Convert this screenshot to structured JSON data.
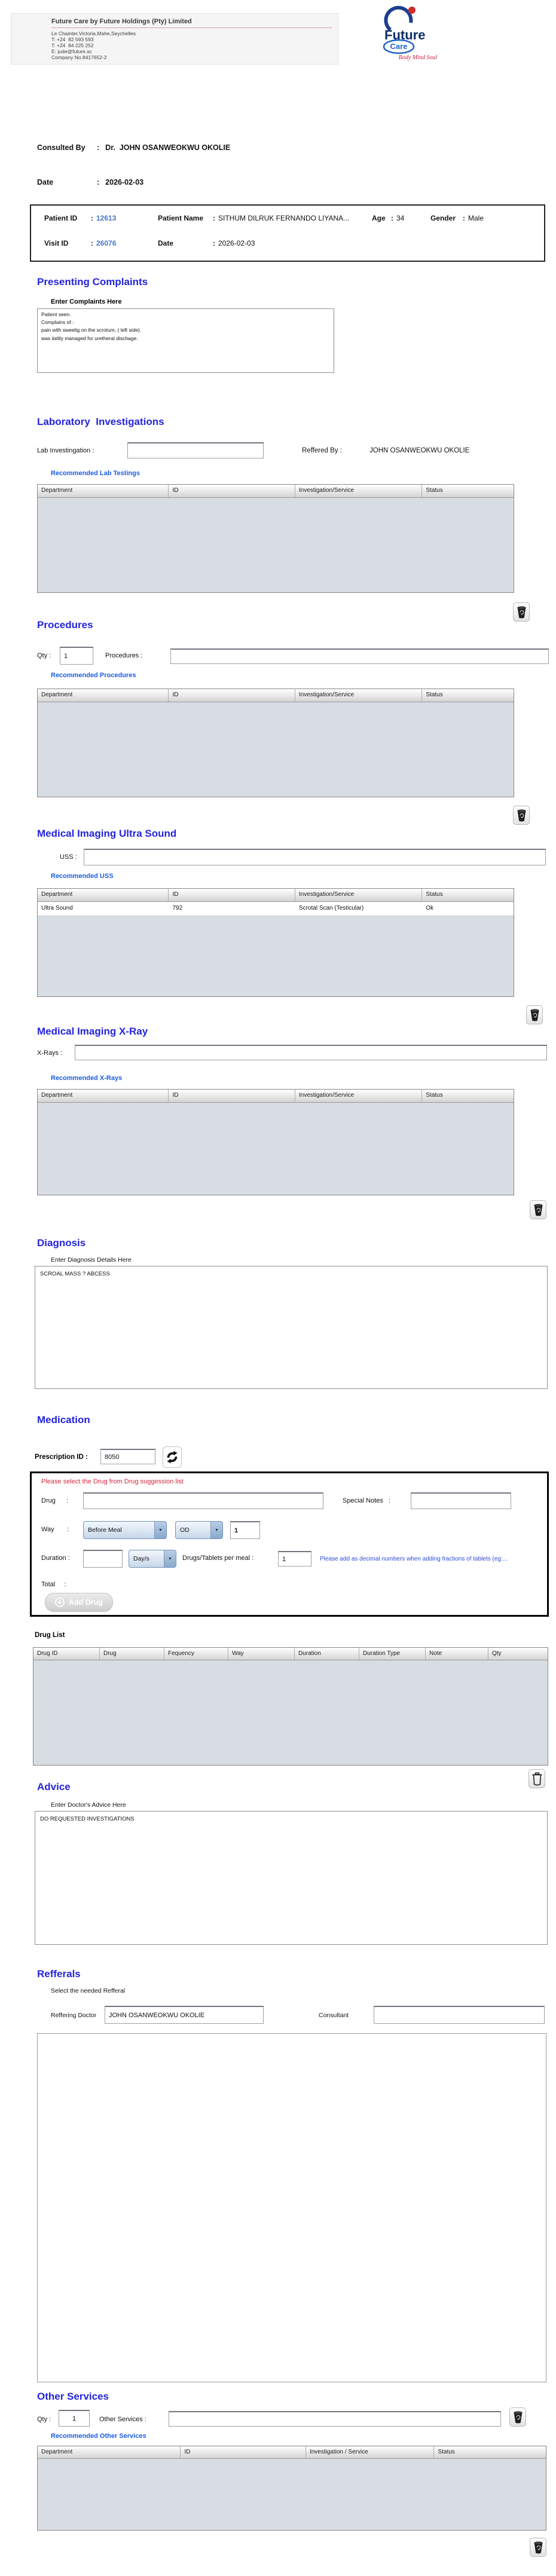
{
  "sep": ":",
  "header": {
    "company_name": "Future Care by Future Holdings (Pty) Limited",
    "address_lines": [
      "Le Chainter,Victoria,Mahe,Seychelles",
      "T: +24  82 593 593",
      "T: +24  84 225 252",
      "E: jude@future.sc",
      "Company No.8417652-2"
    ],
    "logo": {
      "name_top": "Future",
      "name_bottom": "Care",
      "tagline": "Body Mind Soul"
    }
  },
  "consult": {
    "consulted_by_label": "Consulted By",
    "consulted_by_value": "Dr.  JOHN OSANWEOKWU OKOLIE",
    "date_label": "Date",
    "date_value": "2026-02-03"
  },
  "patient": {
    "patient_id_label": "Patient ID",
    "patient_id": "12613",
    "patient_name_label": "Patient Name",
    "patient_name": "SITHUM DILRUK FERNANDO LIYANA...",
    "age_label": "Age",
    "age": "34",
    "gender_label": "Gender",
    "gender": "Male",
    "visit_id_label": "Visit ID",
    "visit_id": "26076",
    "date_label": "Date",
    "date": "2026-02-03"
  },
  "complaints": {
    "title": "Presenting Complaints",
    "label": "Enter Complaints Here",
    "text": "Patient seen.\nComplains of :\npain with sweelig on the scrotum, ( left side).\nwas iiattly managed for uretheral dischage."
  },
  "laboratory": {
    "title": "Laboratory  Investigations",
    "input_label": "Lab Investingation :",
    "input_value": "",
    "reffered_by_label": "Reffered By :",
    "reffered_by": "JOHN OSANWEOKWU OKOLIE",
    "link": "Recommended Lab Testings",
    "table": {
      "columns": [
        "Department",
        "ID",
        "Investigation/Service",
        "Status"
      ]
    }
  },
  "procedures": {
    "title": "Procedures",
    "qty_label": "Qty :",
    "qty_value": "1",
    "input_label": "Procedures :",
    "input_value": "",
    "link": "Recommended Procedures",
    "table": {
      "columns": [
        "Department",
        "ID",
        "Investigation/Service",
        "Status"
      ]
    }
  },
  "uss": {
    "title": "Medical Imaging Ultra Sound",
    "input_label": "USS :",
    "input_value": "",
    "link": "Recommended USS",
    "table": {
      "columns": [
        "Department",
        "ID",
        "Investigation/Service",
        "Status"
      ],
      "rows": [
        [
          "Ultra Sound",
          "792",
          "Scrotal Scan (Testicular)",
          "Ok"
        ]
      ]
    }
  },
  "xray": {
    "title": "Medical Imaging X-Ray",
    "input_label": "X-Rays :",
    "input_value": "",
    "link": "Recommended X-Rays",
    "table": {
      "columns": [
        "Department",
        "ID",
        "Investigation/Service",
        "Status"
      ]
    }
  },
  "diagnosis": {
    "title": "Diagnosis",
    "label": "Enter Diagnosis Details Here",
    "text": "SCROAL MASS ? ABCESS"
  },
  "medication": {
    "title": "Medication",
    "prescription_id_label": "Prescription ID :",
    "prescription_id": "8050",
    "panel_warning": "Please select the Drug from Drug suggession list",
    "drug_label": "Drug      :",
    "drug_value": "",
    "special_notes_label": "Special Notes   :",
    "special_notes_value": "",
    "way_label": "Way       :",
    "way_select": "Before Meal",
    "frequency_select": "OD",
    "frequency_qty": "1",
    "duration_label": "Duration :",
    "duration_value": "",
    "duration_type_select": "Day/s",
    "per_meal_label": "Drugs/Tablets per meal :",
    "per_meal_value": "1",
    "fraction_note": "Please add as decimal numbers when adding fractions of tablets (eg:...",
    "total_label": "Total     :",
    "add_drug_button": "Add Drug",
    "drug_list_label": "Drug List",
    "table": {
      "columns": [
        "Drug ID",
        "Drug",
        "Fequency",
        "Way",
        "Duration",
        "Duration Type",
        "Note",
        "Qty"
      ]
    }
  },
  "advice": {
    "title": "Advice",
    "label": "Enter Doctor's Advice Here",
    "text": "DO REQUESTED INVESTIGATIONS"
  },
  "refferals": {
    "title": "Refferals",
    "label": "Select the needed Refferal",
    "reffering_doctor_label": "Reffering Doctor",
    "reffering_doctor": "JOHN OSANWEOKWU OKOLIE",
    "consultant_label": "Consultant",
    "consultant_value": ""
  },
  "other_services": {
    "title": "Other Services",
    "qty_label": "Qty :",
    "qty_value": "1",
    "input_label": "Other Services :",
    "input_value": "",
    "link": "Recommended Other Services",
    "table": {
      "columns": [
        "Department",
        "ID",
        "Investigation / Service",
        "Status"
      ]
    }
  }
}
